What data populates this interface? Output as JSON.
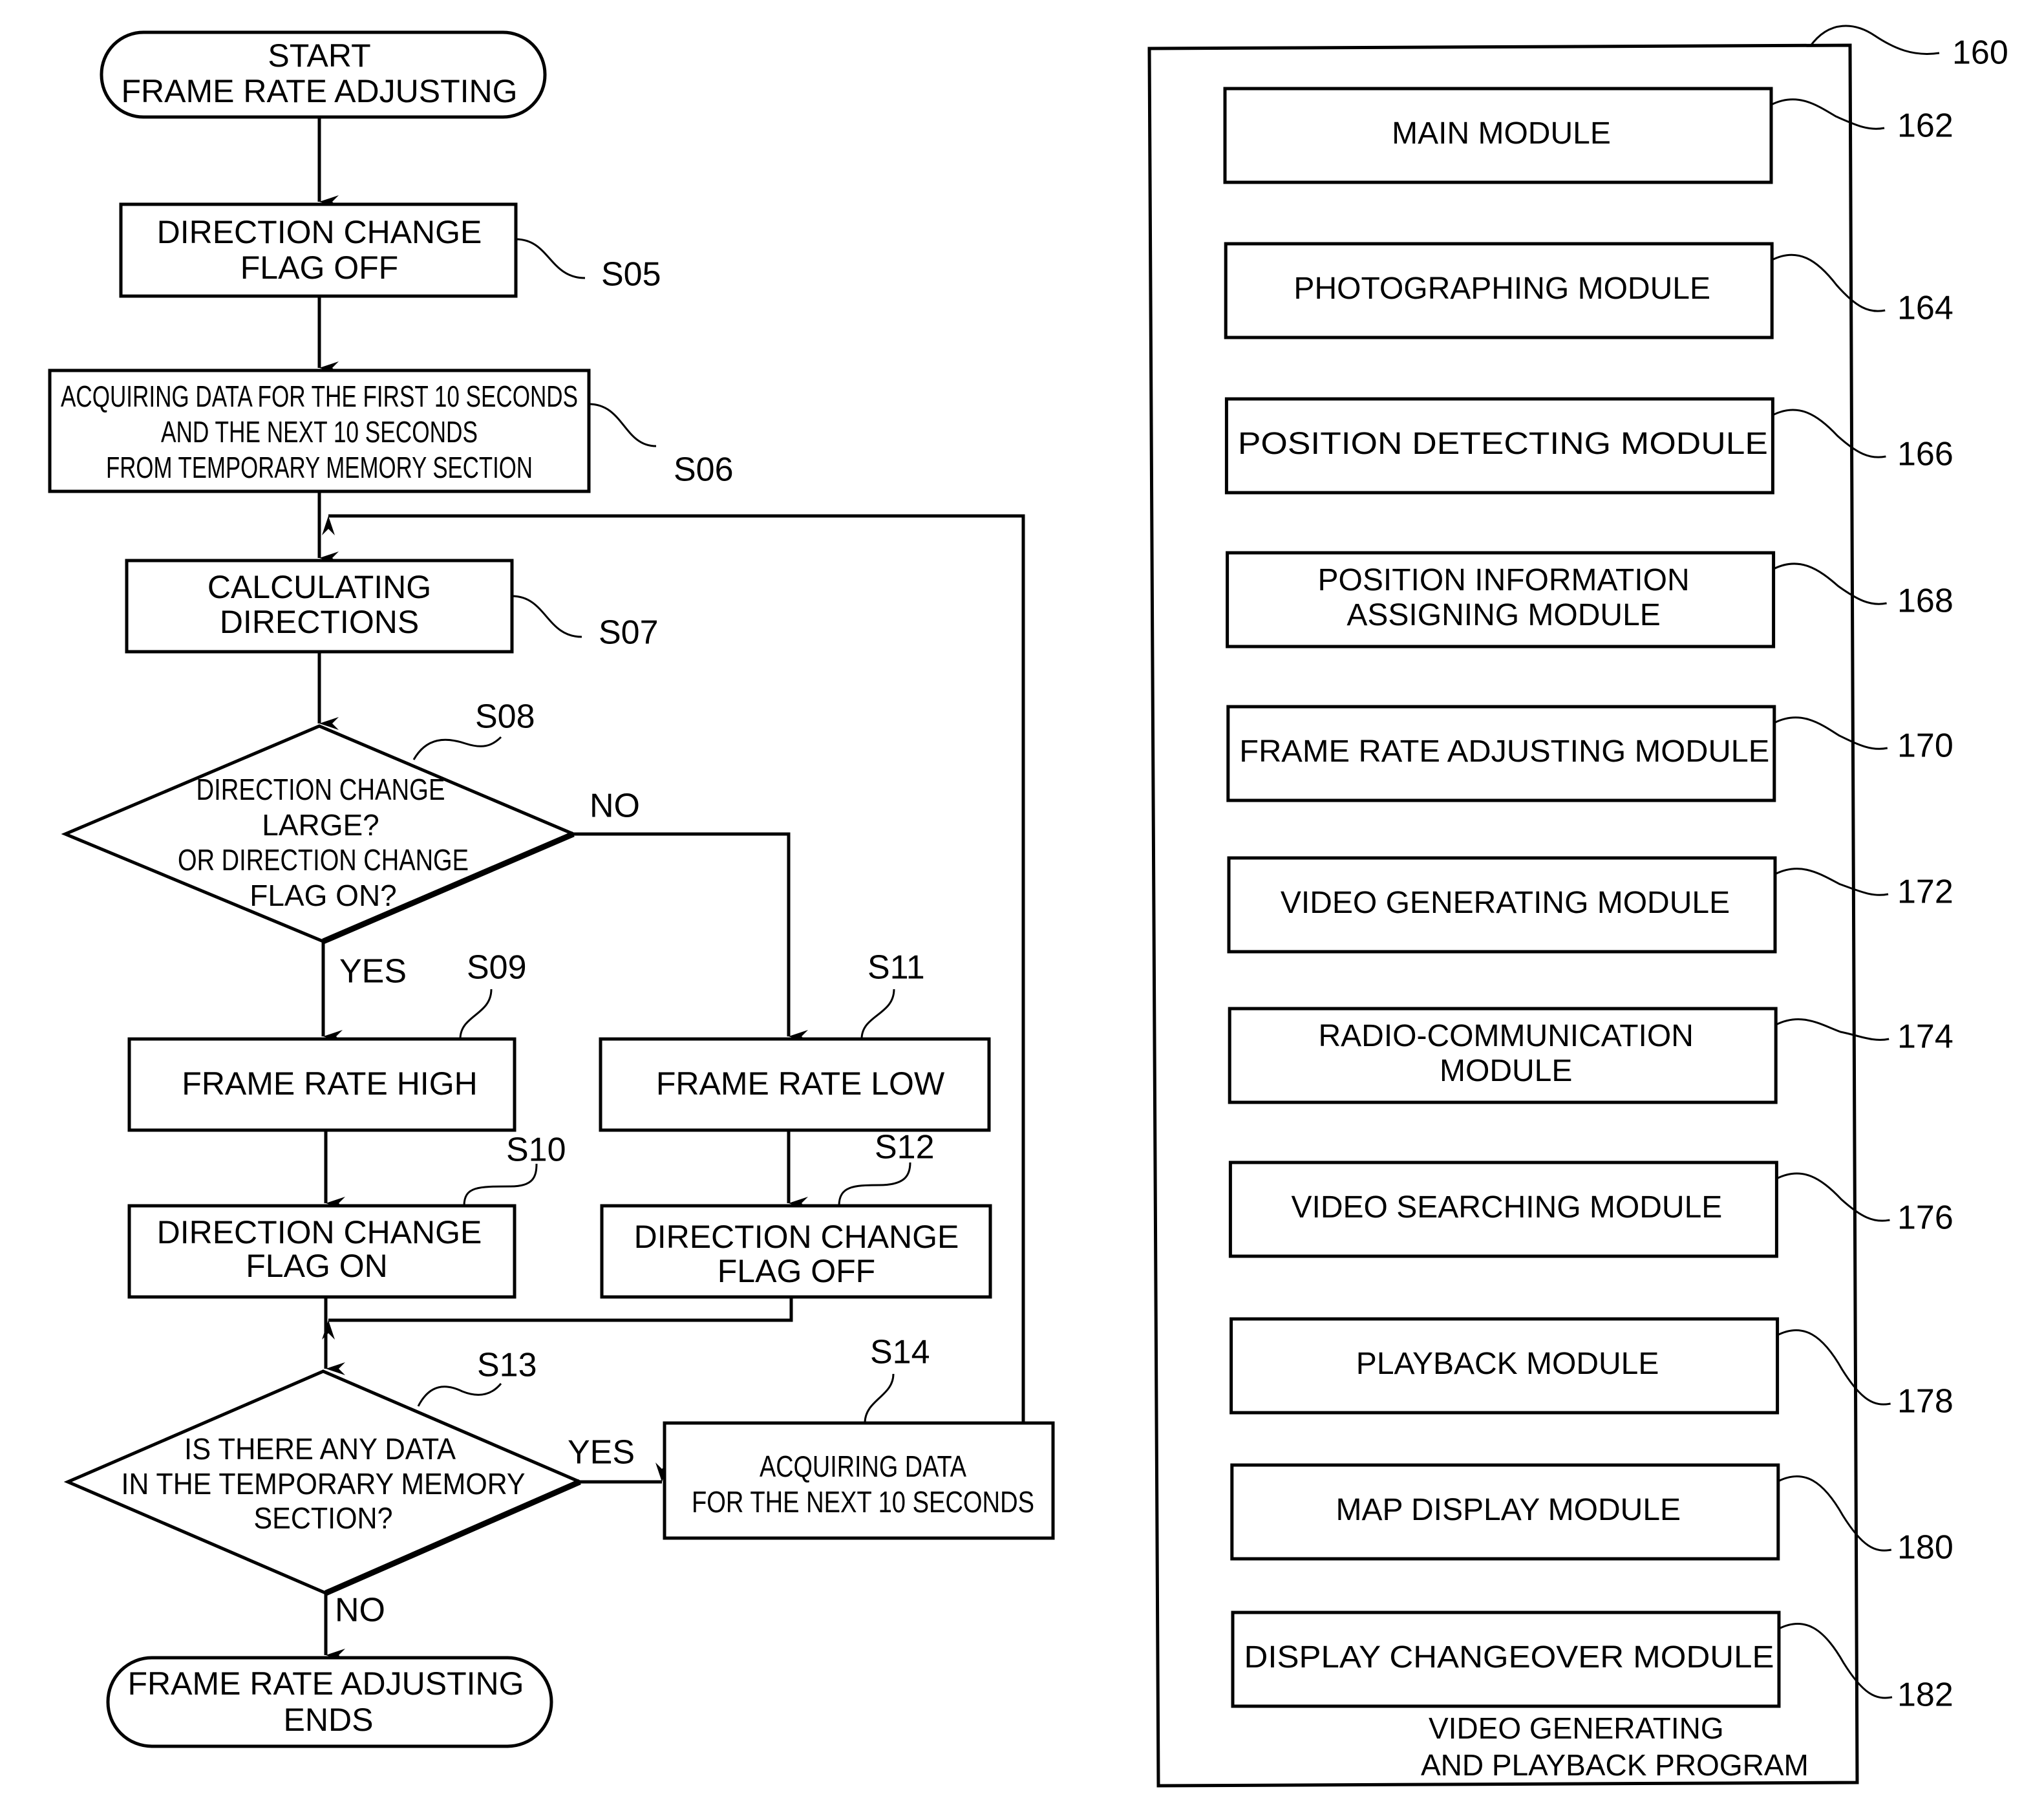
{
  "flowchart": {
    "start": [
      "START",
      "FRAME RATE ADJUSTING"
    ],
    "s05": {
      "id": "S05",
      "lines": [
        "DIRECTION CHANGE",
        "FLAG OFF"
      ]
    },
    "s06": {
      "id": "S06",
      "lines": [
        "ACQUIRING DATA FOR THE FIRST 10 SECONDS",
        "AND THE NEXT 10 SECONDS",
        "FROM TEMPORARY MEMORY SECTION"
      ]
    },
    "s07": {
      "id": "S07",
      "lines": [
        "CALCULATING",
        "DIRECTIONS"
      ]
    },
    "s08": {
      "id": "S08",
      "lines": [
        "DIRECTION CHANGE",
        "LARGE?",
        "OR DIRECTION CHANGE",
        "FLAG ON?"
      ],
      "yes": "YES",
      "no": "NO"
    },
    "s09": {
      "id": "S09",
      "lines": [
        "FRAME RATE HIGH"
      ]
    },
    "s10": {
      "id": "S10",
      "lines": [
        "DIRECTION CHANGE",
        "FLAG ON"
      ]
    },
    "s11": {
      "id": "S11",
      "lines": [
        "FRAME RATE LOW"
      ]
    },
    "s12": {
      "id": "S12",
      "lines": [
        "DIRECTION CHANGE",
        "FLAG OFF"
      ]
    },
    "s13": {
      "id": "S13",
      "lines": [
        "IS THERE ANY DATA",
        "IN THE TEMPORARY MEMORY",
        "SECTION?"
      ],
      "yes": "YES",
      "no": "NO"
    },
    "s14": {
      "id": "S14",
      "lines": [
        "ACQUIRING DATA",
        "FOR THE NEXT 10 SECONDS"
      ]
    },
    "end": [
      "FRAME RATE ADJUSTING",
      "ENDS"
    ]
  },
  "program": {
    "ref": "160",
    "caption": [
      "VIDEO GENERATING",
      "AND PLAYBACK PROGRAM"
    ],
    "modules": [
      {
        "ref": "162",
        "lines": [
          "MAIN MODULE"
        ]
      },
      {
        "ref": "164",
        "lines": [
          "PHOTOGRAPHING MODULE"
        ]
      },
      {
        "ref": "166",
        "lines": [
          "POSITION DETECTING MODULE"
        ]
      },
      {
        "ref": "168",
        "lines": [
          "POSITION INFORMATION",
          "ASSIGNING MODULE"
        ]
      },
      {
        "ref": "170",
        "lines": [
          "FRAME RATE ADJUSTING MODULE"
        ]
      },
      {
        "ref": "172",
        "lines": [
          "VIDEO GENERATING MODULE"
        ]
      },
      {
        "ref": "174",
        "lines": [
          "RADIO-COMMUNICATION",
          "MODULE"
        ]
      },
      {
        "ref": "176",
        "lines": [
          "VIDEO SEARCHING MODULE"
        ]
      },
      {
        "ref": "178",
        "lines": [
          "PLAYBACK MODULE"
        ]
      },
      {
        "ref": "180",
        "lines": [
          "MAP DISPLAY MODULE"
        ]
      },
      {
        "ref": "182",
        "lines": [
          "DISPLAY CHANGEOVER MODULE"
        ]
      }
    ]
  }
}
